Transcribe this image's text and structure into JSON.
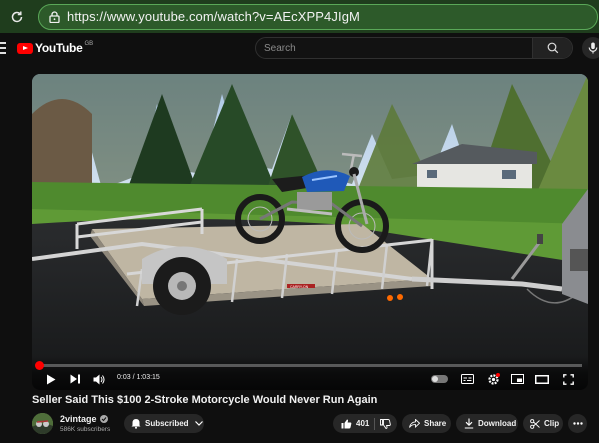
{
  "browser": {
    "url": "https://www.youtube.com/watch?v=AEcXPP4JIgM"
  },
  "header": {
    "logo_text": "YouTube",
    "region": "GB",
    "search_placeholder": "Search"
  },
  "player": {
    "time_display": "0:03 / 1:03:15",
    "progress_fraction": 0.0008,
    "trailer_plate_text": "CARRY-ON"
  },
  "video": {
    "title": "Seller Said This $100 2-Stroke Motorcycle Would Never Run Again"
  },
  "channel": {
    "name": "2vintage",
    "subscribers": "586K subscribers",
    "subscribe_label": "Subscribed"
  },
  "actions": {
    "like_count": "401",
    "share_label": "Share",
    "download_label": "Download",
    "clip_label": "Clip"
  },
  "icons": [
    "reload-icon",
    "lock-icon",
    "menu-icon",
    "search-icon",
    "mic-icon",
    "play-icon",
    "next-icon",
    "volume-icon",
    "autoplay-toggle",
    "subtitles-icon",
    "settings-icon",
    "miniplayer-icon",
    "theater-icon",
    "fullscreen-icon",
    "verified-icon",
    "bell-icon",
    "thumbs-up-icon",
    "thumbs-down-icon",
    "share-icon",
    "download-icon",
    "scissors-icon",
    "more-icon"
  ],
  "colors": {
    "browser_bar": "#1f3d1d",
    "url_border": "#5aa858",
    "brand_red": "#ff0000",
    "page_bg": "#0f0f0f",
    "pill_bg": "#272727"
  }
}
